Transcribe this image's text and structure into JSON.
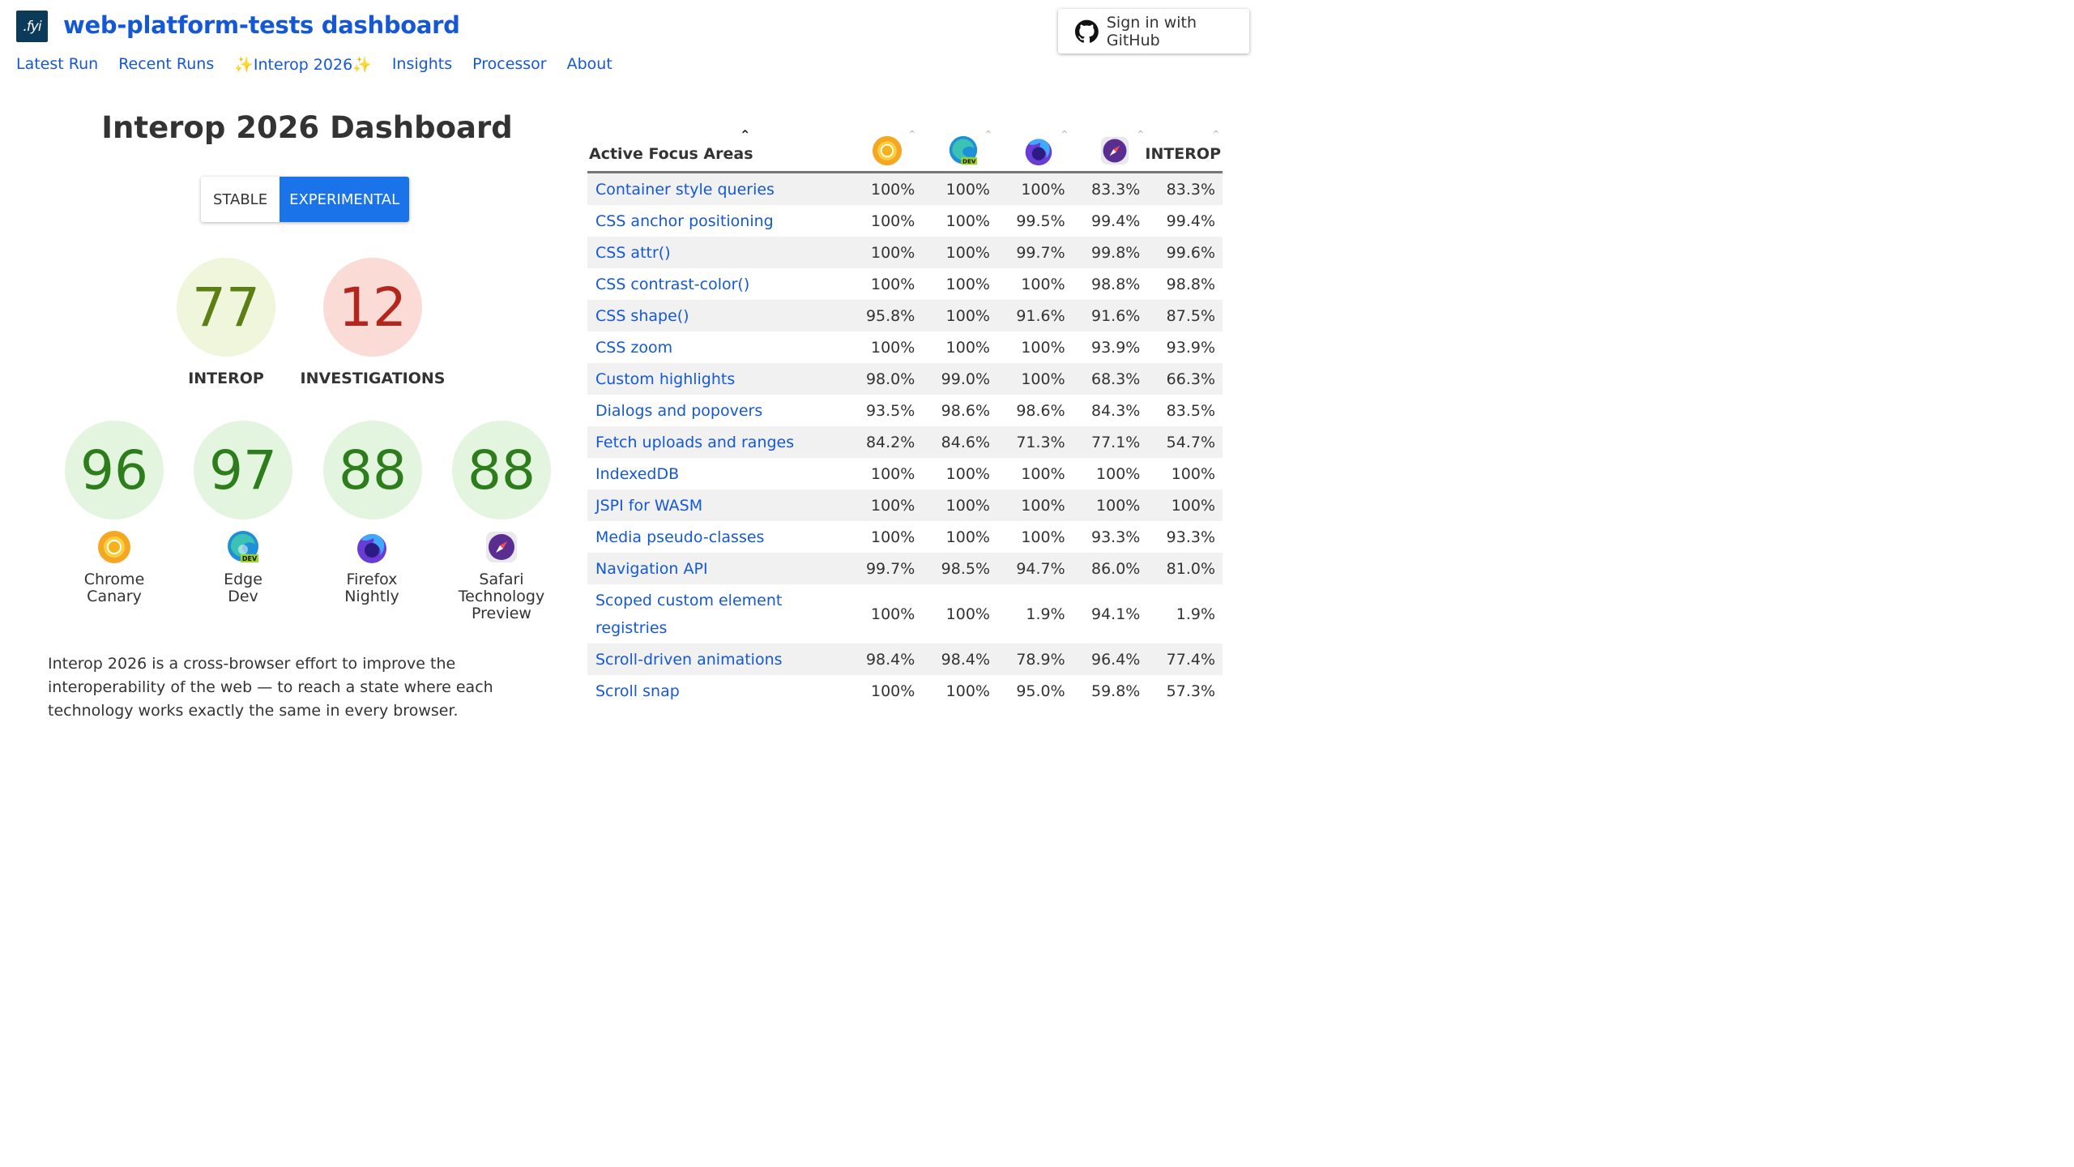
{
  "header": {
    "logo_text": ".fyi",
    "title": "web-platform-tests dashboard",
    "signin_label": "Sign in with GitHub",
    "nav": [
      "Latest Run",
      "Recent Runs",
      "✨Interop 2026✨",
      "Insights",
      "Processor",
      "About"
    ]
  },
  "dashboard": {
    "title": "Interop 2026 Dashboard",
    "toggle": {
      "stable": "STABLE",
      "experimental": "EXPERIMENTAL",
      "selected": "EXPERIMENTAL"
    },
    "interop_score": "77",
    "interop_label": "INTEROP",
    "investigations_score": "12",
    "investigations_label": "INVESTIGATIONS",
    "browsers": [
      {
        "score": "96",
        "line1": "Chrome",
        "line2": "Canary",
        "line3": "",
        "icon": "chrome-canary-icon"
      },
      {
        "score": "97",
        "line1": "Edge",
        "line2": "Dev",
        "line3": "",
        "icon": "edge-dev-icon"
      },
      {
        "score": "88",
        "line1": "Firefox",
        "line2": "Nightly",
        "line3": "",
        "icon": "firefox-nightly-icon"
      },
      {
        "score": "88",
        "line1": "Safari",
        "line2": "Technology",
        "line3": "Preview",
        "icon": "safari-tp-icon"
      }
    ],
    "description": "Interop 2026 is a cross-browser effort to improve the interoperability of the web — to reach a state where each technology works exactly the same in every browser."
  },
  "table": {
    "header": "Active Focus Areas",
    "sort_glyph": "⌃",
    "interop_header": "INTEROP",
    "rows": [
      {
        "name": "Container style queries",
        "values": [
          "100%",
          "100%",
          "100%",
          "83.3%",
          "83.3%"
        ]
      },
      {
        "name": "CSS anchor positioning",
        "values": [
          "100%",
          "100%",
          "99.5%",
          "99.4%",
          "99.4%"
        ]
      },
      {
        "name": "CSS attr()",
        "values": [
          "100%",
          "100%",
          "99.7%",
          "99.8%",
          "99.6%"
        ]
      },
      {
        "name": "CSS contrast-color()",
        "values": [
          "100%",
          "100%",
          "100%",
          "98.8%",
          "98.8%"
        ]
      },
      {
        "name": "CSS shape()",
        "values": [
          "95.8%",
          "100%",
          "91.6%",
          "91.6%",
          "87.5%"
        ]
      },
      {
        "name": "CSS zoom",
        "values": [
          "100%",
          "100%",
          "100%",
          "93.9%",
          "93.9%"
        ]
      },
      {
        "name": "Custom highlights",
        "values": [
          "98.0%",
          "99.0%",
          "100%",
          "68.3%",
          "66.3%"
        ]
      },
      {
        "name": "Dialogs and popovers",
        "values": [
          "93.5%",
          "98.6%",
          "98.6%",
          "84.3%",
          "83.5%"
        ]
      },
      {
        "name": "Fetch uploads and ranges",
        "values": [
          "84.2%",
          "84.6%",
          "71.3%",
          "77.1%",
          "54.7%"
        ]
      },
      {
        "name": "IndexedDB",
        "values": [
          "100%",
          "100%",
          "100%",
          "100%",
          "100%"
        ]
      },
      {
        "name": "JSPI for WASM",
        "values": [
          "100%",
          "100%",
          "100%",
          "100%",
          "100%"
        ]
      },
      {
        "name": "Media pseudo-classes",
        "values": [
          "100%",
          "100%",
          "100%",
          "93.3%",
          "93.3%"
        ]
      },
      {
        "name": "Navigation API",
        "values": [
          "99.7%",
          "98.5%",
          "94.7%",
          "86.0%",
          "81.0%"
        ]
      },
      {
        "name": "Scoped custom element registries",
        "values": [
          "100%",
          "100%",
          "1.9%",
          "94.1%",
          "1.9%"
        ]
      },
      {
        "name": "Scroll-driven animations",
        "values": [
          "98.4%",
          "98.4%",
          "78.9%",
          "96.4%",
          "77.4%"
        ]
      },
      {
        "name": "Scroll snap",
        "values": [
          "100%",
          "100%",
          "95.0%",
          "59.8%",
          "57.3%"
        ]
      }
    ]
  }
}
